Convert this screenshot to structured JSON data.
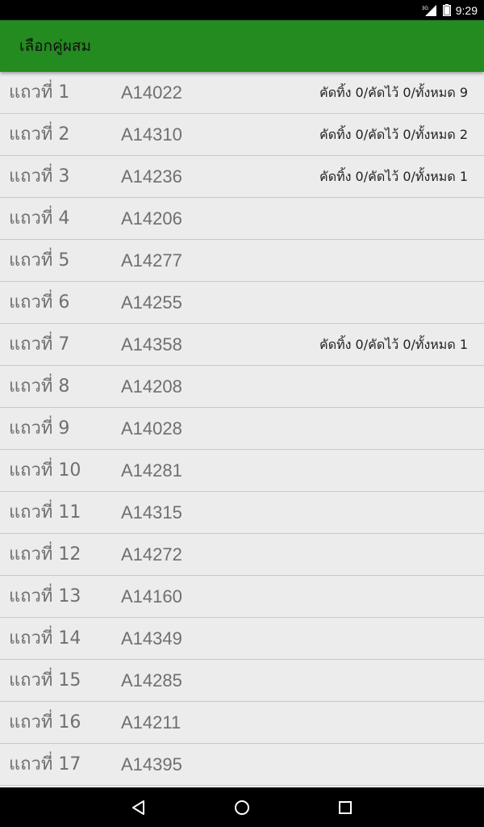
{
  "status_bar": {
    "network": "3G",
    "time": "9:29"
  },
  "app_bar": {
    "title": "เลือกคู่ผสม"
  },
  "rows": [
    {
      "label": "แถวที่ 1",
      "code": "A14022",
      "stats": "คัดทิ้ง 0/คัดไว้  0/ทั้งหมด 9"
    },
    {
      "label": "แถวที่ 2",
      "code": "A14310",
      "stats": "คัดทิ้ง 0/คัดไว้  0/ทั้งหมด 2"
    },
    {
      "label": "แถวที่ 3",
      "code": "A14236",
      "stats": "คัดทิ้ง 0/คัดไว้  0/ทั้งหมด 1"
    },
    {
      "label": "แถวที่ 4",
      "code": "A14206",
      "stats": ""
    },
    {
      "label": "แถวที่ 5",
      "code": "A14277",
      "stats": ""
    },
    {
      "label": "แถวที่ 6",
      "code": "A14255",
      "stats": ""
    },
    {
      "label": "แถวที่ 7",
      "code": "A14358",
      "stats": "คัดทิ้ง 0/คัดไว้  0/ทั้งหมด 1"
    },
    {
      "label": "แถวที่ 8",
      "code": "A14208",
      "stats": ""
    },
    {
      "label": "แถวที่ 9",
      "code": "A14028",
      "stats": ""
    },
    {
      "label": "แถวที่ 10",
      "code": "A14281",
      "stats": ""
    },
    {
      "label": "แถวที่ 11",
      "code": "A14315",
      "stats": ""
    },
    {
      "label": "แถวที่ 12",
      "code": "A14272",
      "stats": ""
    },
    {
      "label": "แถวที่ 13",
      "code": "A14160",
      "stats": ""
    },
    {
      "label": "แถวที่ 14",
      "code": "A14349",
      "stats": ""
    },
    {
      "label": "แถวที่ 15",
      "code": "A14285",
      "stats": ""
    },
    {
      "label": "แถวที่ 16",
      "code": "A14211",
      "stats": ""
    },
    {
      "label": "แถวที่ 17",
      "code": "A14395",
      "stats": ""
    }
  ],
  "nav_bar": {
    "back_icon": "back-triangle-icon",
    "home_icon": "home-circle-icon",
    "recents_icon": "recents-square-icon"
  },
  "colors": {
    "app_bar": "#238b1f",
    "list_background": "#ececec",
    "divider": "#c9c9c9"
  }
}
